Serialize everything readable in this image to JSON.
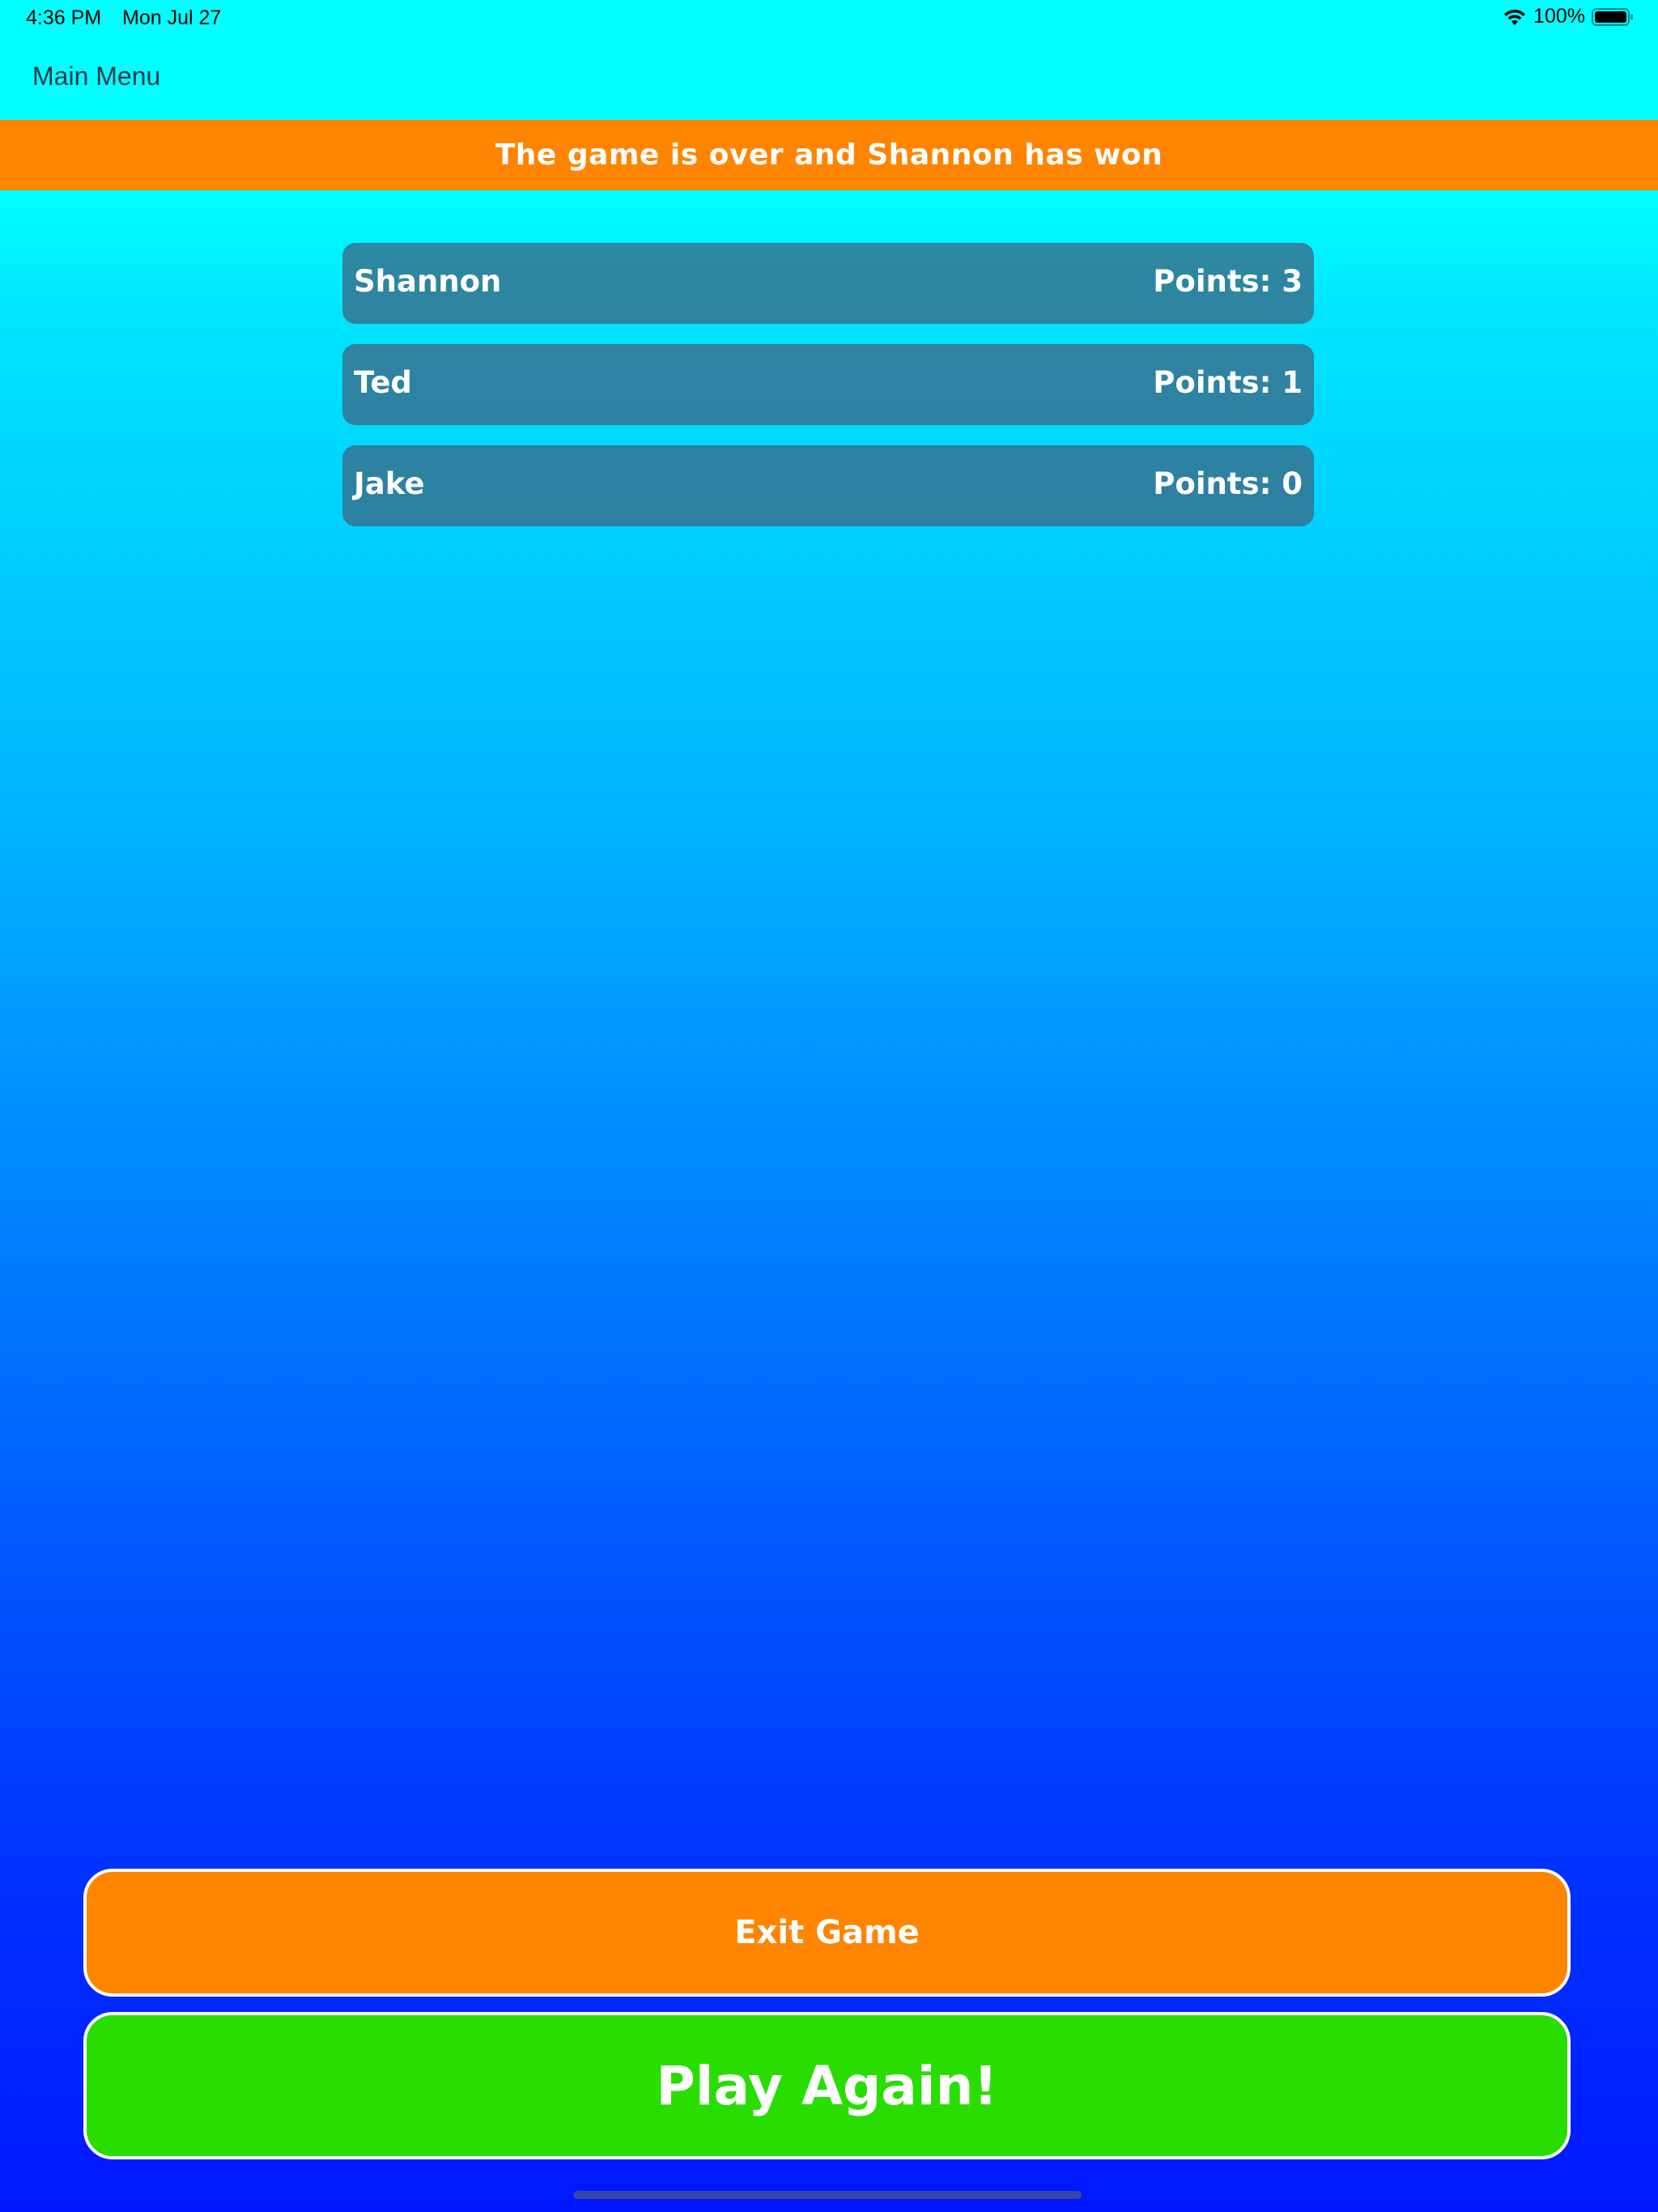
{
  "status_bar": {
    "time": "4:36 PM",
    "date": "Mon Jul 27",
    "battery_percent": "100%",
    "icons": [
      "wifi-icon",
      "battery-icon"
    ]
  },
  "nav": {
    "back_label": "Main Menu"
  },
  "banner": {
    "message": "The game is over and Shannon has won"
  },
  "scores": [
    {
      "name": "Shannon",
      "points": "Points: 3"
    },
    {
      "name": "Ted",
      "points": "Points: 1"
    },
    {
      "name": "Jake",
      "points": "Points: 0"
    }
  ],
  "buttons": {
    "exit_label": "Exit Game",
    "play_again_label": "Play Again!"
  },
  "colors": {
    "banner": "#ff8400",
    "exit_button": "#ff8400",
    "play_button": "#29dd00",
    "background_top": "#00ffff",
    "background_bottom": "#0018ff"
  }
}
